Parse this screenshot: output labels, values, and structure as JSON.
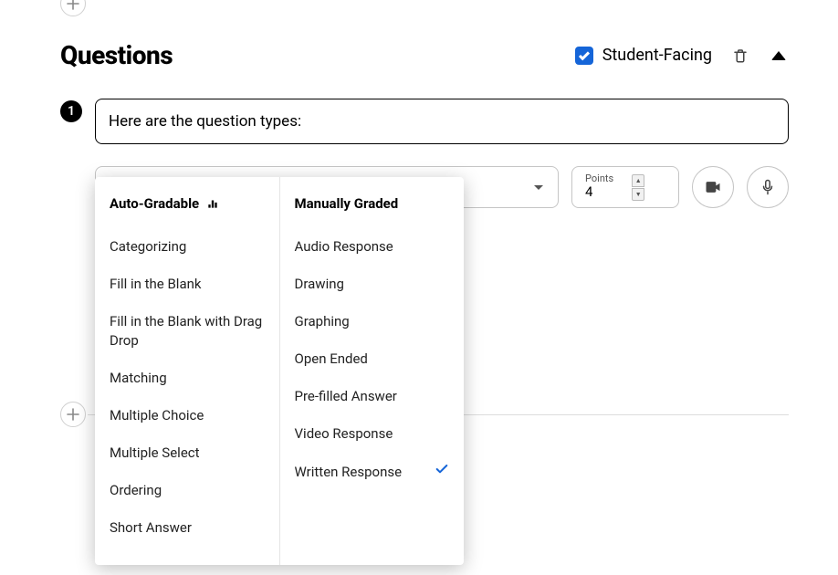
{
  "header": {
    "title": "Questions",
    "student_facing_label": "Student-Facing",
    "student_facing_checked": true
  },
  "question": {
    "number": "1",
    "text": "Here are the question types:"
  },
  "points": {
    "label": "Points",
    "value": "4"
  },
  "dropdown": {
    "auto_gradable_header": "Auto-Gradable",
    "manually_graded_header": "Manually Graded",
    "auto_gradable": [
      "Categorizing",
      "Fill in the Blank",
      "Fill in the Blank with Drag Drop",
      "Matching",
      "Multiple Choice",
      "Multiple Select",
      "Ordering",
      "Short Answer"
    ],
    "manually_graded": [
      "Audio Response",
      "Drawing",
      "Graphing",
      "Open Ended",
      "Pre-filled Answer",
      "Video Response",
      "Written Response"
    ],
    "selected": "Written Response"
  }
}
